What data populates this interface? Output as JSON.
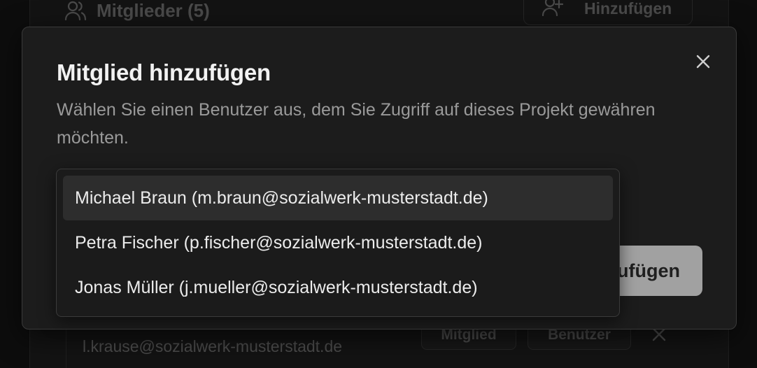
{
  "background": {
    "members_header": {
      "title": "Mitglieder (5)",
      "icon": "users-icon"
    },
    "add_button": {
      "label": "Hinzufügen",
      "icon": "user-plus-icon"
    },
    "member_row": {
      "email": "l.krause@sozialwerk-musterstadt.de",
      "role_badge": "Mitglied",
      "type_badge": "Benutzer",
      "remove_icon": "close-icon"
    }
  },
  "dialog": {
    "title": "Mitglied hinzufügen",
    "description": "Wählen Sie einen Benutzer aus, dem Sie Zugriff auf dieses Projekt gewähren möchten.",
    "close_icon": "close-icon",
    "submit_label": "Hinzufügen",
    "dropdown": {
      "highlighted_index": 0,
      "options": [
        {
          "label": "Michael Braun (m.braun@sozialwerk-musterstadt.de)"
        },
        {
          "label": "Petra Fischer (p.fischer@sozialwerk-musterstadt.de)"
        },
        {
          "label": "Jonas Müller (j.mueller@sozialwerk-musterstadt.de)"
        }
      ]
    }
  },
  "colors": {
    "dialog_background": "#1c1c1c",
    "dialog_border": "#3a3a3a",
    "title_text": "#f2f2f2",
    "description_text": "#9a9a9a",
    "option_highlight": "#2d2d2d",
    "submit_button": "#b9b9b9"
  }
}
